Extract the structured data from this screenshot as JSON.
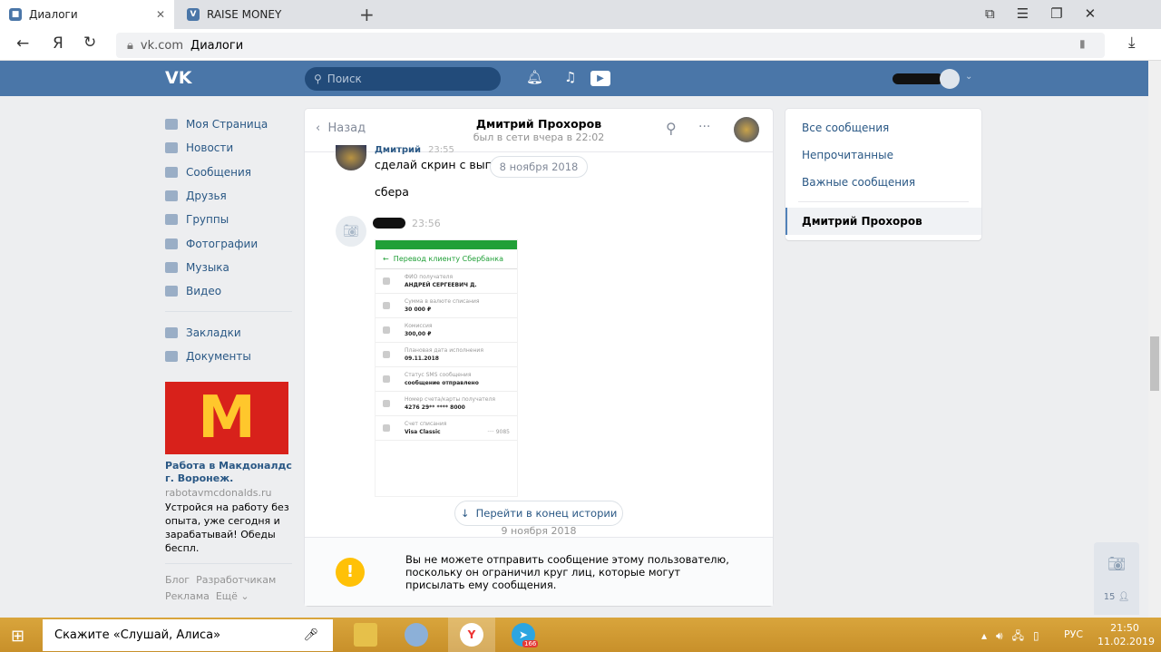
{
  "browser": {
    "tabs": [
      {
        "label": "Диалоги"
      },
      {
        "label": "RAISE MONEY"
      }
    ],
    "url_domain": "vk.com",
    "url_title": "Диалоги"
  },
  "vk": {
    "search_placeholder": "Поиск",
    "nav": [
      {
        "label": "Моя Страница"
      },
      {
        "label": "Новости"
      },
      {
        "label": "Сообщения"
      },
      {
        "label": "Друзья"
      },
      {
        "label": "Группы"
      },
      {
        "label": "Фотографии"
      },
      {
        "label": "Музыка"
      },
      {
        "label": "Видео"
      },
      {
        "label": "Закладки"
      },
      {
        "label": "Документы"
      }
    ],
    "ad": {
      "title": "Работа в Макдоналдс г. Воронеж.",
      "domain": "rabotavmcdonalds.ru",
      "text": "Устройся на работу без опыта, уже сегодня и зарабатывай! Обеды беспл."
    },
    "footer": {
      "blog": "Блог",
      "dev": "Разработчикам",
      "ads": "Реклама",
      "more": "Ещё ⌄"
    },
    "chat": {
      "back": "Назад",
      "name": "Дмитрий Прохоров",
      "status": "был в сети вчера в 22:02",
      "sender": "Дмитрий",
      "time1": "23:55",
      "msg1": "сделай скрин с выпис",
      "msg2": "сбера",
      "date_pill": "8 ноября 2018",
      "time2": "23:56",
      "receipt": {
        "title": "Перевод клиенту Сбербанка",
        "fields": [
          {
            "label": "ФИО получателя",
            "value": "АНДРЕЙ СЕРГЕЕВИЧ Д."
          },
          {
            "label": "Сумма в валюте списания",
            "value": "30 000 ₽"
          },
          {
            "label": "Комиссия",
            "value": "300,00 ₽"
          },
          {
            "label": "Плановая дата исполнения",
            "value": "09.11.2018"
          },
          {
            "label": "Статус SMS сообщения",
            "value": "сообщение отправлено"
          },
          {
            "label": "Номер счета/карты получателя",
            "value": "4276 29** **** 8000"
          },
          {
            "label": "Счет списания",
            "value": "Visa Classic"
          }
        ],
        "card_tail": "···· 9085"
      },
      "goto_end": "Перейти в конец истории",
      "date2": "9 ноября 2018",
      "notice": "Вы не можете отправить сообщение этому пользователю, поскольку он ограничил круг лиц, которые могут присылать ему сообщения."
    },
    "right": [
      {
        "label": "Все сообщения"
      },
      {
        "label": "Непрочитанные"
      },
      {
        "label": "Важные сообщения"
      },
      {
        "label": "Дмитрий Прохоров"
      }
    ],
    "friends_count": "15"
  },
  "taskbar": {
    "search": "Скажите «Слушай, Алиса»",
    "lang": "РУС",
    "time": "21:50",
    "date": "11.02.2019",
    "telegram_badge": "166"
  }
}
